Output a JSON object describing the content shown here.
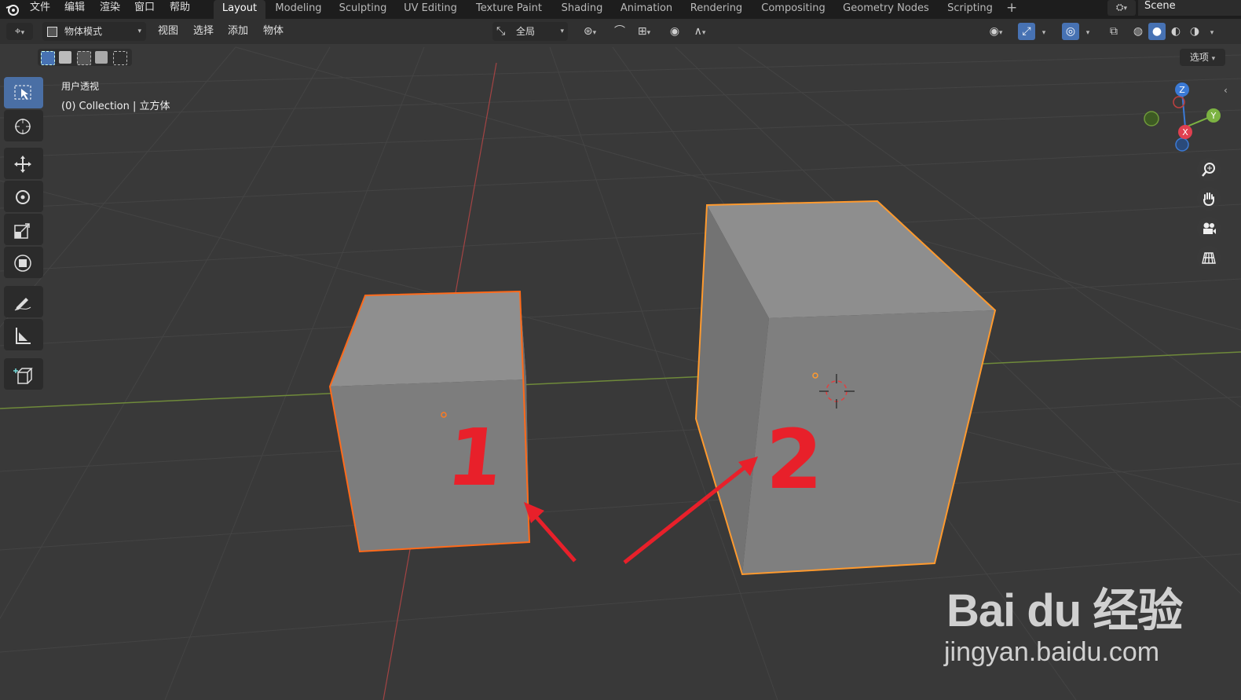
{
  "menubar": {
    "items": [
      "文件",
      "编辑",
      "渲染",
      "窗口",
      "帮助"
    ]
  },
  "workspaces": {
    "tabs": [
      "Layout",
      "Modeling",
      "Sculpting",
      "UV Editing",
      "Texture Paint",
      "Shading",
      "Animation",
      "Rendering",
      "Compositing",
      "Geometry Nodes",
      "Scripting"
    ],
    "active": "Layout",
    "add_label": "+"
  },
  "scene": {
    "name": "Scene"
  },
  "header": {
    "mode": "物体模式",
    "menus": [
      "视图",
      "选择",
      "添加",
      "物体"
    ],
    "orientation": "全局",
    "options_label": "选项"
  },
  "viewport": {
    "view_name": "用户透视",
    "collection_info": "(0) Collection | 立方体"
  },
  "gizmo": {
    "z_label": "Z",
    "y_label": "Y",
    "x_label": "X"
  },
  "annotations": {
    "label_1": "1",
    "label_2": "2"
  },
  "watermark": {
    "logo_text": "Bai du 经验",
    "url": "jingyan.baidu.com"
  },
  "colors": {
    "background": "#393939",
    "selected_outline": "#ff8c2a",
    "annotation_red": "#e8202a",
    "active_tool": "#4a6fa5"
  },
  "tools": [
    "select-box",
    "cursor",
    "move",
    "rotate",
    "scale",
    "transform",
    "annotate",
    "measure",
    "add-cube"
  ]
}
